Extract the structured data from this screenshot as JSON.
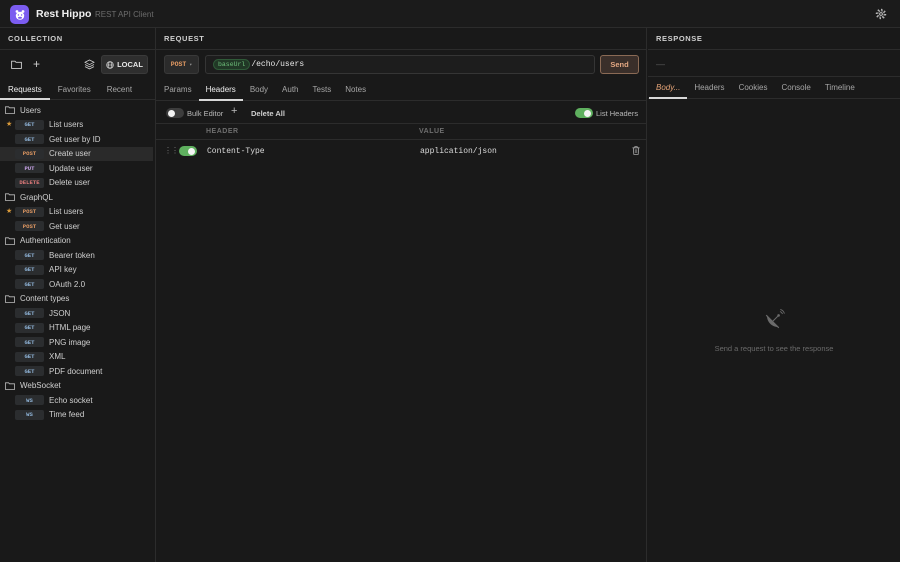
{
  "app": {
    "title": "Rest Hippo",
    "subtitle": "REST API Client"
  },
  "collection": {
    "heading": "COLLECTION",
    "env_label": "LOCAL",
    "tabs": [
      {
        "label": "Requests",
        "active": true
      },
      {
        "label": "Favorites",
        "active": false
      },
      {
        "label": "Recent",
        "active": false
      }
    ],
    "folders": [
      {
        "name": "Users",
        "items": [
          {
            "method": "GET",
            "name": "List users",
            "starred": true,
            "selected": false
          },
          {
            "method": "GET",
            "name": "Get user by ID",
            "starred": false,
            "selected": false
          },
          {
            "method": "POST",
            "name": "Create user",
            "starred": false,
            "selected": true
          },
          {
            "method": "PUT",
            "name": "Update user",
            "starred": false,
            "selected": false
          },
          {
            "method": "DELETE",
            "name": "Delete user",
            "starred": false,
            "selected": false
          }
        ]
      },
      {
        "name": "GraphQL",
        "items": [
          {
            "method": "POST",
            "name": "List users",
            "starred": true,
            "selected": false
          },
          {
            "method": "POST",
            "name": "Get user",
            "starred": false,
            "selected": false
          }
        ]
      },
      {
        "name": "Authentication",
        "items": [
          {
            "method": "GET",
            "name": "Bearer token",
            "starred": false,
            "selected": false
          },
          {
            "method": "GET",
            "name": "API key",
            "starred": false,
            "selected": false
          },
          {
            "method": "GET",
            "name": "OAuth 2.0",
            "starred": false,
            "selected": false
          }
        ]
      },
      {
        "name": "Content types",
        "items": [
          {
            "method": "GET",
            "name": "JSON",
            "starred": false,
            "selected": false
          },
          {
            "method": "GET",
            "name": "HTML page",
            "starred": false,
            "selected": false
          },
          {
            "method": "GET",
            "name": "PNG image",
            "starred": false,
            "selected": false
          },
          {
            "method": "GET",
            "name": "XML",
            "starred": false,
            "selected": false
          },
          {
            "method": "GET",
            "name": "PDF document",
            "starred": false,
            "selected": false
          }
        ]
      },
      {
        "name": "WebSocket",
        "items": [
          {
            "method": "WS",
            "name": "Echo socket",
            "starred": false,
            "selected": false
          },
          {
            "method": "WS",
            "name": "Time feed",
            "starred": false,
            "selected": false
          }
        ]
      }
    ]
  },
  "request": {
    "heading": "REQUEST",
    "method": "POST",
    "url_variable": "baseUrl",
    "url_path": "/echo/users",
    "send_label": "Send",
    "tabs": [
      {
        "label": "Params",
        "active": false
      },
      {
        "label": "Headers",
        "active": true
      },
      {
        "label": "Body",
        "active": false
      },
      {
        "label": "Auth",
        "active": false
      },
      {
        "label": "Tests",
        "active": false
      },
      {
        "label": "Notes",
        "active": false
      }
    ],
    "bulk_editor_label": "Bulk Editor",
    "bulk_editor_on": false,
    "delete_all_label": "Delete All",
    "list_headers_label": "List Headers",
    "list_headers_on": true,
    "columns": {
      "header": "HEADER",
      "value": "VALUE"
    },
    "headers": [
      {
        "enabled": true,
        "name": "Content-Type",
        "value": "application/json"
      }
    ]
  },
  "response": {
    "heading": "RESPONSE",
    "placeholder": "—",
    "tabs": [
      {
        "label": "Body...",
        "active": true
      },
      {
        "label": "Headers",
        "active": false
      },
      {
        "label": "Cookies",
        "active": false
      },
      {
        "label": "Console",
        "active": false
      },
      {
        "label": "Timeline",
        "active": false
      }
    ],
    "empty_message": "Send a request to see the response"
  },
  "icons": {
    "logo": "hippo-logo-icon",
    "settings": "gear-icon",
    "new_folder": "folder-icon",
    "new_request": "plus-icon",
    "environments": "layers-icon",
    "env": "globe-icon",
    "folder": "folder-icon",
    "favorite": "star-icon",
    "drag": "drag-handle-icon",
    "delete": "trash-icon",
    "method_dropdown": "chevron-down-icon",
    "empty": "satellite-dish-icon"
  },
  "colors": {
    "accent": "#7b5cf0",
    "get": "#8fb4d8",
    "post": "#e39a63",
    "put": "#c9a4e8",
    "delete": "#e07a7a",
    "ws": "#8fb4d8",
    "toggle_on": "#5fb05f",
    "send": "#e2a782"
  }
}
